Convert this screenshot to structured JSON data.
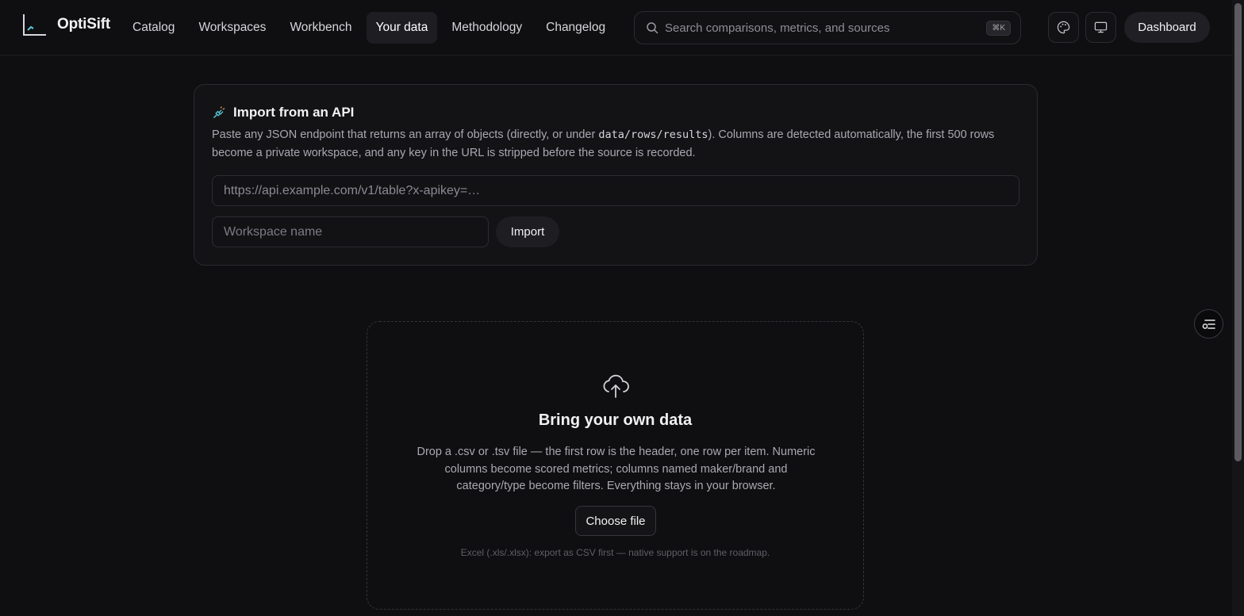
{
  "brand": {
    "name": "OptiSift"
  },
  "nav": {
    "items": [
      {
        "label": "Catalog"
      },
      {
        "label": "Workspaces"
      },
      {
        "label": "Workbench"
      },
      {
        "label": "Your data",
        "active": true
      },
      {
        "label": "Methodology"
      },
      {
        "label": "Changelog"
      }
    ]
  },
  "search": {
    "placeholder": "Search comparisons, metrics, and sources",
    "shortcut": "⌘K"
  },
  "header": {
    "dashboard_label": "Dashboard"
  },
  "api_import": {
    "title": "Import from an API",
    "desc_before": "Paste any JSON endpoint that returns an array of objects (directly, or under ",
    "desc_code": "data/rows/results",
    "desc_after": "). Columns are detected automatically, the first 500 rows become a private workspace, and any key in the URL is stripped before the source is recorded.",
    "url_placeholder": "https://api.example.com/v1/table?x-apikey=…",
    "workspace_placeholder": "Workspace name",
    "import_label": "Import"
  },
  "upload": {
    "title": "Bring your own data",
    "description": "Drop a .csv or .tsv file — the first row is the header, one row per item. Numeric columns become scored metrics; columns named maker/brand and category/type become filters. Everything stays in your browser.",
    "choose_label": "Choose file",
    "note": "Excel (.xls/.xlsx): export as CSV first — native support is on the roadmap."
  },
  "colors": {
    "background": "#0f0f11",
    "accent": "#5cc8d8"
  }
}
